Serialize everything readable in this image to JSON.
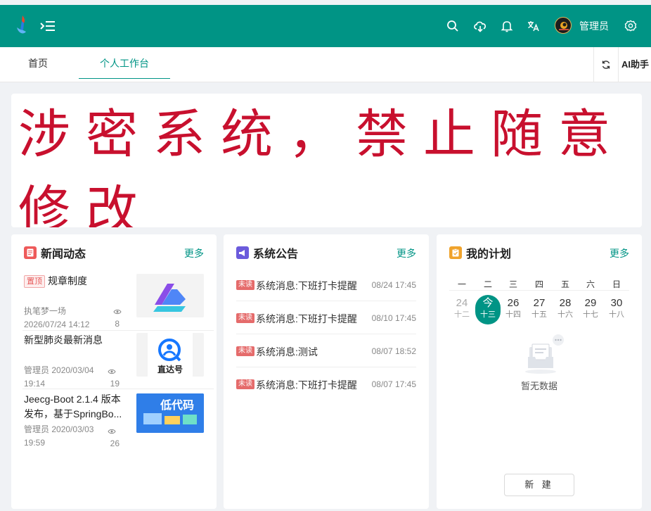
{
  "header": {
    "user_name": "管理员",
    "icons": [
      "logo-icon",
      "menu-unfold-icon",
      "search-icon",
      "cloud-download-icon",
      "bell-icon",
      "translate-icon",
      "avatar",
      "settings-icon"
    ],
    "bg_color": "#009485"
  },
  "tabs": [
    {
      "label": "首页"
    },
    {
      "label": "个人工作台"
    }
  ],
  "ai_button": "AI助手",
  "banner": {
    "text": "涉密系统，禁止随意修改",
    "color": "#c8102e"
  },
  "news": {
    "title": "新闻动态",
    "more": "更多",
    "items": [
      {
        "tag": "置顶",
        "title": "规章制度",
        "author": "执笔梦一场",
        "time": "2026/07/24 14:12",
        "views": "8"
      },
      {
        "tag": "",
        "title": "新型肺炎最新消息",
        "author": "管理员",
        "time": "2020/03/04 19:14",
        "views": "19"
      },
      {
        "tag": "",
        "title": "Jeecg-Boot 2.1.4 版本发布，基于SpringBo...",
        "author": "管理员",
        "time": "2020/03/03 19:59",
        "views": "26"
      }
    ],
    "thumb2_text": "直达号",
    "thumb3_text": "低代码"
  },
  "announcements": {
    "title": "系统公告",
    "more": "更多",
    "items": [
      {
        "tag": "未读",
        "title": "系统消息:下班打卡提醒",
        "time": "08/24 17:45"
      },
      {
        "tag": "未读",
        "title": "系统消息:下班打卡提醒",
        "time": "08/10 17:45"
      },
      {
        "tag": "未读",
        "title": "系统消息:测试",
        "time": "08/07 18:52"
      },
      {
        "tag": "未读",
        "title": "系统消息:下班打卡提醒",
        "time": "08/07 17:45"
      }
    ]
  },
  "plan": {
    "title": "我的计划",
    "more": "更多",
    "weekdays": [
      "一",
      "二",
      "三",
      "四",
      "五",
      "六",
      "日"
    ],
    "days": [
      {
        "n": "24",
        "l": "十二"
      },
      {
        "n": "今",
        "l": "十三"
      },
      {
        "n": "26",
        "l": "十四"
      },
      {
        "n": "27",
        "l": "十五"
      },
      {
        "n": "28",
        "l": "十六"
      },
      {
        "n": "29",
        "l": "十七"
      },
      {
        "n": "30",
        "l": "十八"
      }
    ],
    "empty_text": "暂无数据",
    "new_button": "新 建"
  }
}
